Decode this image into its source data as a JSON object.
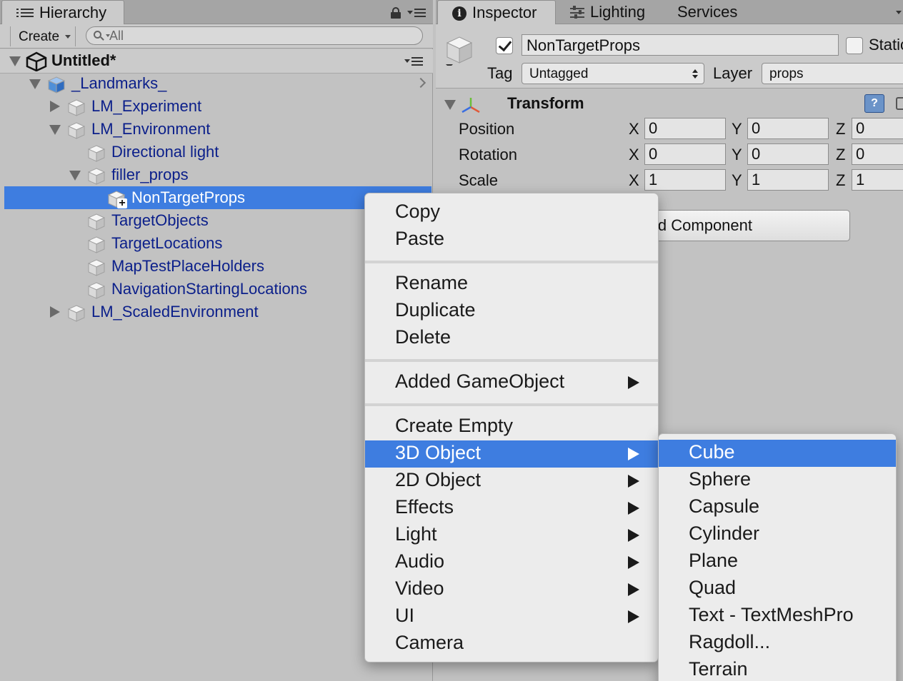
{
  "hierarchy": {
    "tab_label": "Hierarchy",
    "create_label": "Create",
    "search_placeholder": "All",
    "scene_name": "Untitled*",
    "items": [
      {
        "label": "_Landmarks_",
        "depth": 0,
        "fold": "open"
      },
      {
        "label": "LM_Experiment",
        "depth": 1,
        "fold": "closed"
      },
      {
        "label": "LM_Environment",
        "depth": 1,
        "fold": "open"
      },
      {
        "label": "Directional light",
        "depth": 2,
        "fold": "none"
      },
      {
        "label": "filler_props",
        "depth": 2,
        "fold": "open"
      },
      {
        "label": "NonTargetProps",
        "depth": 3,
        "fold": "none",
        "selected": true
      },
      {
        "label": "TargetObjects",
        "depth": 2,
        "fold": "none"
      },
      {
        "label": "TargetLocations",
        "depth": 2,
        "fold": "none"
      },
      {
        "label": "MapTestPlaceHolders",
        "depth": 2,
        "fold": "none"
      },
      {
        "label": "NavigationStartingLocations",
        "depth": 2,
        "fold": "none"
      },
      {
        "label": "LM_ScaledEnvironment",
        "depth": 1,
        "fold": "closed"
      }
    ]
  },
  "inspector": {
    "tabs": [
      "Inspector",
      "Lighting",
      "Services"
    ],
    "object_name": "NonTargetProps",
    "active": true,
    "static_label": "Static",
    "tag_label": "Tag",
    "tag_value": "Untagged",
    "layer_label": "Layer",
    "layer_value": "props",
    "transform_title": "Transform",
    "transform": {
      "position": {
        "label": "Position",
        "x": "0",
        "y": "0",
        "z": "0"
      },
      "rotation": {
        "label": "Rotation",
        "x": "0",
        "y": "0",
        "z": "0"
      },
      "scale": {
        "label": "Scale",
        "x": "1",
        "y": "1",
        "z": "1"
      }
    },
    "add_component_label": "Add Component"
  },
  "context_menu": {
    "copy": "Copy",
    "paste": "Paste",
    "rename": "Rename",
    "duplicate": "Duplicate",
    "delete": "Delete",
    "added_gameobject": "Added GameObject",
    "create_empty": "Create Empty",
    "object_3d": "3D Object",
    "object_2d": "2D Object",
    "effects": "Effects",
    "light": "Light",
    "audio": "Audio",
    "video": "Video",
    "ui": "UI",
    "camera": "Camera"
  },
  "submenu_3d": [
    "Cube",
    "Sphere",
    "Capsule",
    "Cylinder",
    "Plane",
    "Quad",
    "Text - TextMeshPro",
    "Ragdoll...",
    "Terrain"
  ],
  "colors": {
    "selection": "#3e7de0",
    "hierarchy_text": "#0b1f8a",
    "panel_bg": "#c2c2c2"
  }
}
